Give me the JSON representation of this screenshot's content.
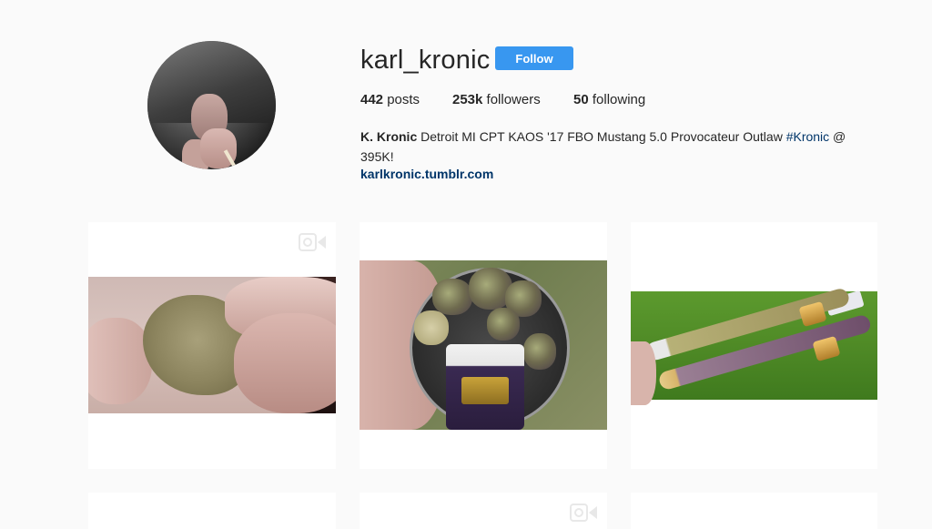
{
  "profile": {
    "username": "karl_kronic",
    "follow_label": "Follow",
    "stats": [
      {
        "count": "442",
        "label": " posts"
      },
      {
        "count": "253k",
        "label": " followers"
      },
      {
        "count": "50",
        "label": " following"
      }
    ],
    "bio": {
      "name": "K. Kronic",
      "text": " Detroit MI CPT KAOS '17 FBO Mustang 5.0 Provocateur Outlaw ",
      "hashtag": "#Kronic",
      "text_end": " @ 395K!"
    },
    "website": "karlkronic.tumblr.com"
  },
  "posts": [
    {
      "type": "video"
    },
    {
      "type": "image"
    },
    {
      "type": "image"
    },
    {
      "type": "image"
    },
    {
      "type": "video"
    },
    {
      "type": "image"
    }
  ],
  "icons": {
    "video": "video-camera-icon"
  },
  "colors": {
    "follow_button": "#3897f0",
    "link": "#003569",
    "background": "#fafafa"
  }
}
